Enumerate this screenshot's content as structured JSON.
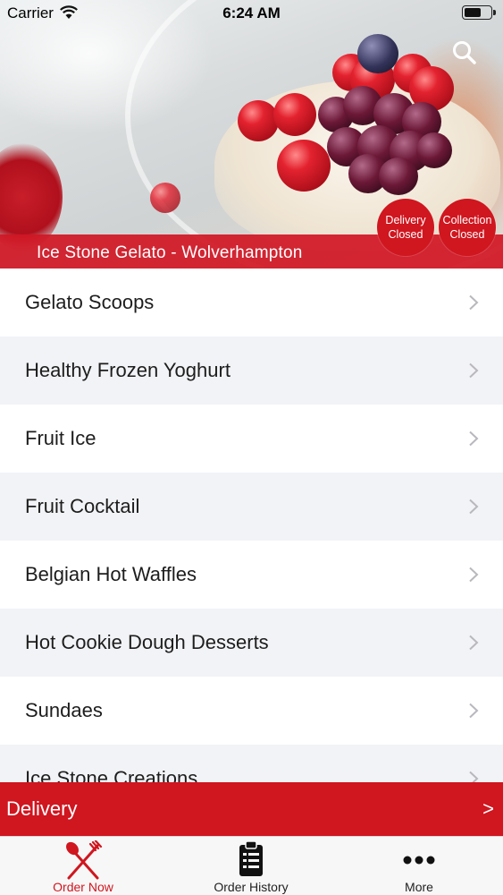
{
  "status_bar": {
    "carrier": "Carrier",
    "time": "6:24 AM"
  },
  "header": {
    "store_name": "Ice Stone Gelato - Wolverhampton",
    "delivery_badge": {
      "line1": "Delivery",
      "line2": "Closed"
    },
    "collection_badge": {
      "line1": "Collection",
      "line2": "Closed"
    },
    "search_icon": "search-icon"
  },
  "menu": {
    "items": [
      {
        "label": "Gelato Scoops"
      },
      {
        "label": "Healthy Frozen Yoghurt"
      },
      {
        "label": "Fruit Ice"
      },
      {
        "label": "Fruit Cocktail"
      },
      {
        "label": "Belgian Hot Waffles"
      },
      {
        "label": "Hot Cookie Dough Desserts"
      },
      {
        "label": "Sundaes"
      },
      {
        "label": "Ice Stone Creations"
      }
    ]
  },
  "delivery_bar": {
    "label": "Delivery",
    "arrow": ">"
  },
  "tabbar": {
    "order_now": "Order Now",
    "order_history": "Order History",
    "more": "More"
  },
  "colors": {
    "brand_red": "#d0161f",
    "row_alt": "#f2f3f6"
  }
}
